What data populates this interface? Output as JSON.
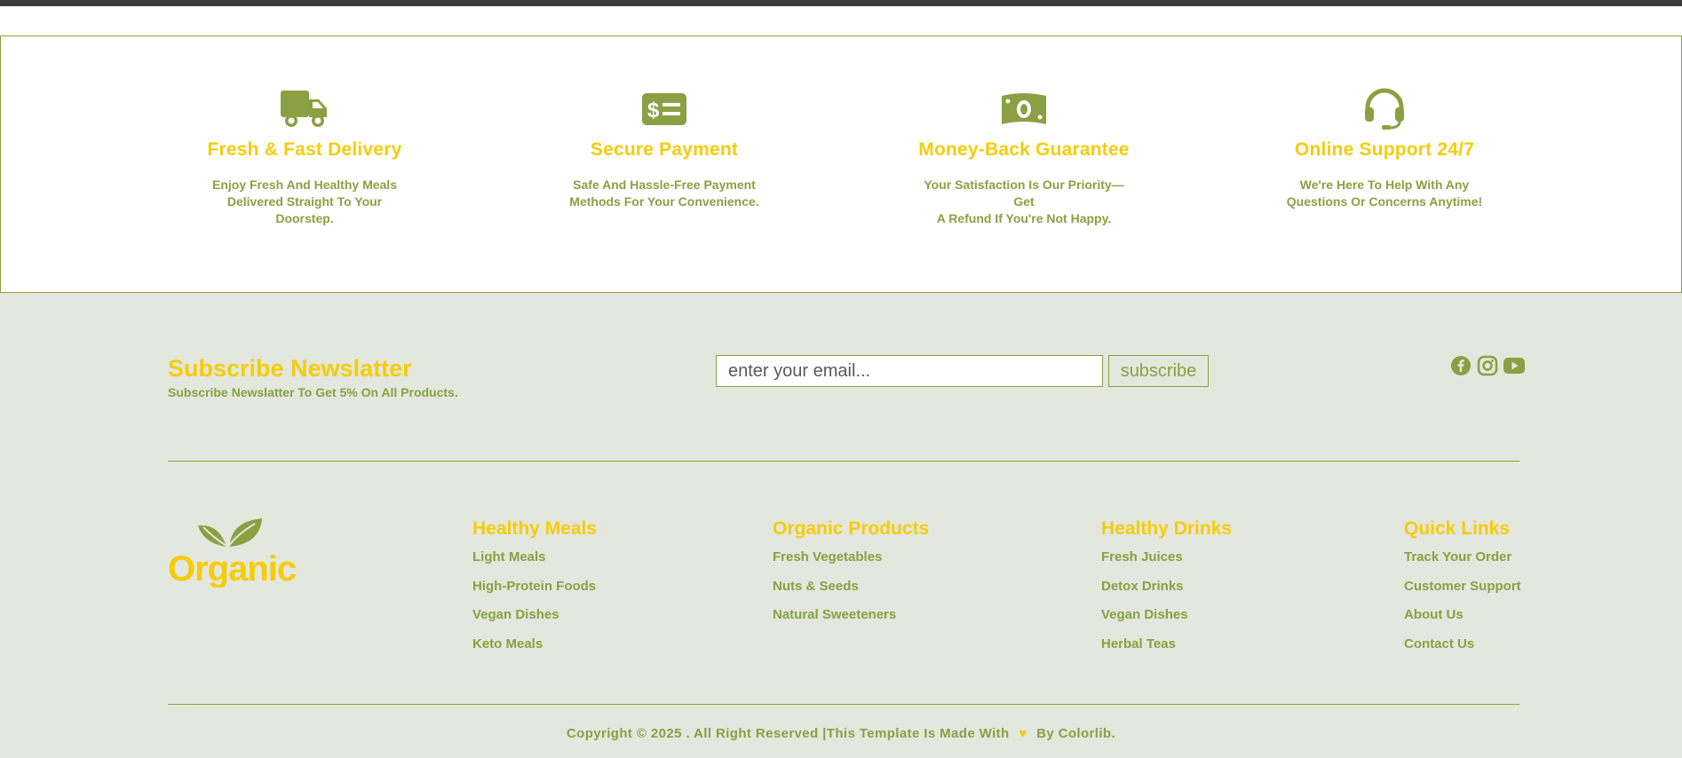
{
  "features": [
    {
      "icon": "truck-icon",
      "title": "Fresh & Fast Delivery",
      "desc_line1": "Enjoy Fresh And Healthy Meals",
      "desc_line2": "Delivered Straight To Your Doorstep."
    },
    {
      "icon": "payment-card-icon",
      "title": "Secure Payment",
      "desc_line1": "Safe And Hassle-Free Payment",
      "desc_line2": "Methods For Your Convenience."
    },
    {
      "icon": "money-bill-icon",
      "title": "Money-Back Guarantee",
      "desc_line1": "Your Satisfaction Is Our Priority—Get",
      "desc_line2": "A Refund If You're Not Happy."
    },
    {
      "icon": "headset-icon",
      "title": "Online Support 24/7",
      "desc_line1": "We're Here To Help With Any",
      "desc_line2": "Questions Or Concerns Anytime!"
    }
  ],
  "newsletter": {
    "title": "Subscribe Newslatter",
    "subtitle": "Subscribe Newslatter To Get 5% On All Products.",
    "email_placeholder": "enter your email...",
    "button_label": "subscribe"
  },
  "socials": [
    "facebook-icon",
    "instagram-icon",
    "youtube-icon"
  ],
  "logo": {
    "text": "Organic"
  },
  "columns": [
    {
      "title": "Healthy Meals",
      "links": [
        "Light Meals",
        "High-Protein Foods",
        "Vegan Dishes",
        "Keto Meals"
      ]
    },
    {
      "title": "Organic Products",
      "links": [
        "Fresh Vegetables",
        "Nuts & Seeds",
        "Natural Sweeteners"
      ]
    },
    {
      "title": "Healthy Drinks",
      "links": [
        "Fresh Juices",
        "Detox Drinks",
        "Vegan Dishes",
        "Herbal Teas"
      ]
    },
    {
      "title": "Quick Links",
      "links": [
        "Track Your Order",
        "Customer Support",
        "About Us",
        "Contact Us"
      ]
    }
  ],
  "copyright": {
    "before": "Copyright © 2025 . All Right Reserved |This Template Is Made With",
    "heart": "♥",
    "after": "By Colorlib."
  },
  "colors": {
    "accent_green": "#8aa043",
    "accent_yellow": "#f5cc0a",
    "footer_bg": "#e4e7dd"
  }
}
